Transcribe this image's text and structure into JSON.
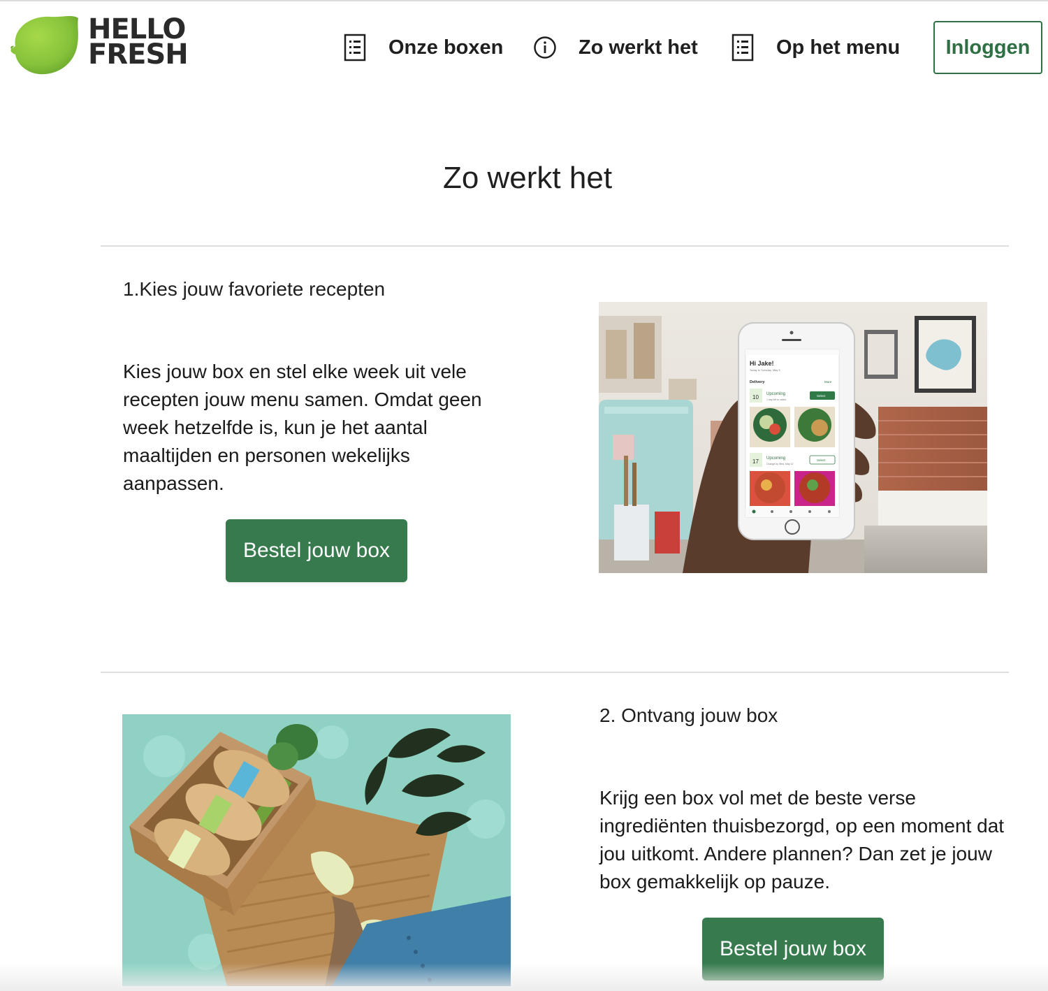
{
  "brand": {
    "name_line1": "HELLO",
    "name_line2": "FRESH",
    "lime_color": "#8cc63f",
    "dark_color": "#2a2a2a",
    "accent_green": "#367a4d"
  },
  "nav": {
    "items": [
      {
        "label": "Onze boxen",
        "icon": "menu-list-icon"
      },
      {
        "label": "Zo werkt het",
        "icon": "info-icon"
      },
      {
        "label": "Op het menu",
        "icon": "menu-list-icon"
      }
    ],
    "login_label": "Inloggen"
  },
  "main": {
    "title": "Zo werkt het",
    "steps": [
      {
        "title": "1.Kies jouw favoriete recepten",
        "text": "Kies jouw box en stel elke week uit vele recepten jouw menu samen. Omdat geen week hetzelfde is, kun je het aantal maaltijden en personen wekelijks aanpassen.",
        "button_label": "Bestel jouw box",
        "image": "phone-app-kitchen-photo",
        "app": {
          "greeting": "Hi Jake!",
          "subgreeting": "Today is Tuesday, May 5",
          "section": "Delivery",
          "more": "More",
          "rows": [
            {
              "day": "10",
              "status": "Upcoming",
              "note": "1 day left to select",
              "action": "Select"
            },
            {
              "day": "17",
              "status": "Upcoming",
              "note": "Change by Wed, May 12",
              "action": "Select"
            }
          ]
        }
      },
      {
        "title": "2. Ontvang jouw box",
        "text": "Krijg een box vol met de beste verse ingrediënten thuisbezorgd, op een moment dat jou uitkomt. Andere plannen? Dan zet je jouw box gemakkelijk op pauze.",
        "button_label": "Bestel jouw box",
        "image": "delivered-box-doormat-photo"
      }
    ]
  }
}
